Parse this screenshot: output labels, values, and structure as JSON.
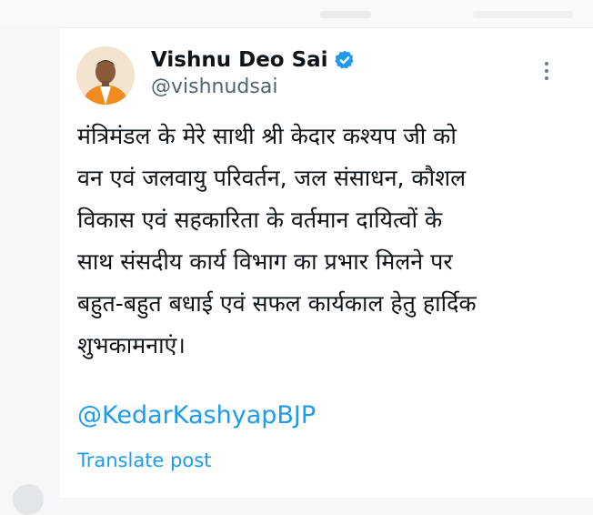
{
  "tweet": {
    "author_name": "Vishnu Deo Sai",
    "handle": "@vishnudsai",
    "verified": true,
    "text": "मंत्रिमंडल के मेरे साथी श्री केदार कश्यप जी को\nवन एवं जलवायु परिवर्तन, जल संसाधन, कौशल\nविकास एवं सहकारिता के वर्तमान दायित्वों के\nसाथ संसदीय कार्य विभाग का प्रभार मिलने पर\nबहुत-बहुत बधाई एवं सफल कार्यकाल हेतु हार्दिक\nशुभकामनाएं।",
    "mention": "@KedarKashyapBJP",
    "translate_label": "Translate post"
  },
  "icons": {
    "verified": "verified-badge-icon",
    "more": "more-options-icon"
  },
  "colors": {
    "accent": "#1d9bf0",
    "text": "#0f1419",
    "secondary": "#536471"
  }
}
